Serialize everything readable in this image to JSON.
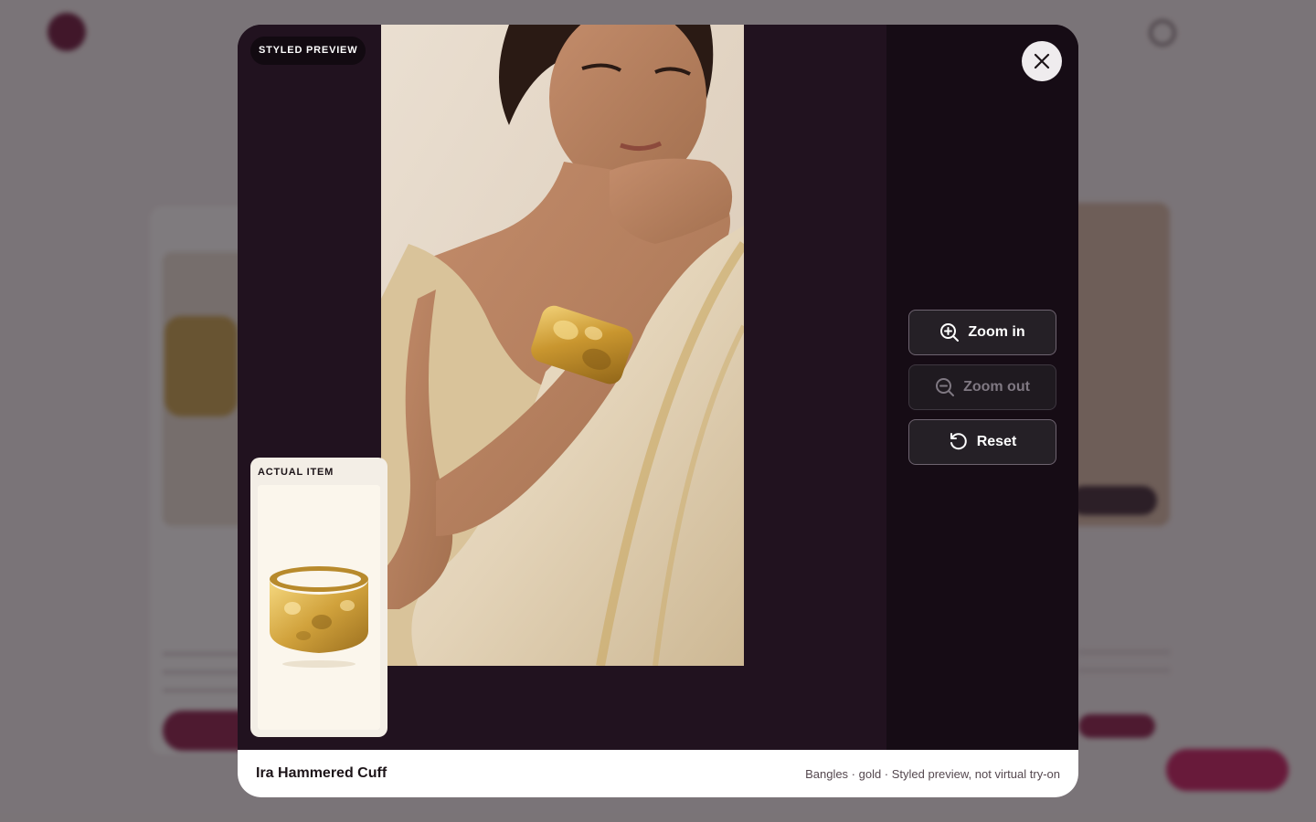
{
  "modal": {
    "badge": "STYLED PREVIEW",
    "inset_label": "ACTUAL ITEM",
    "controls": {
      "zoom_in": "Zoom in",
      "zoom_out": "Zoom out",
      "reset": "Reset"
    },
    "footer": {
      "product_name": "Ira Hammered Cuff",
      "meta": "Bangles · gold · Styled preview, not virtual try-on"
    }
  },
  "icons": {
    "close": "close-icon",
    "zoom_in": "zoom-in-icon",
    "zoom_out": "zoom-out-icon",
    "reset": "reset-icon"
  },
  "colors": {
    "modal_stage": "#21121f",
    "modal_side": "#160c15",
    "brand": "#8a1846",
    "gold": "#c9a24a"
  }
}
